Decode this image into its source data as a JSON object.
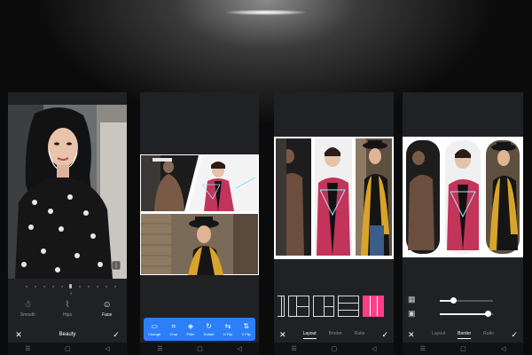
{
  "screens": {
    "beauty": {
      "slider_value": "0",
      "tools": [
        {
          "label": "Smooth",
          "icon": "smooth-icon"
        },
        {
          "label": "Hips",
          "icon": "hips-icon"
        },
        {
          "label": "Face",
          "icon": "face-icon",
          "active": true
        }
      ],
      "title": "Beauty"
    },
    "editor": {
      "tools": [
        {
          "label": "Change",
          "icon": "change-icon"
        },
        {
          "label": "Crop",
          "icon": "crop-icon"
        },
        {
          "label": "Filter",
          "icon": "filter-icon"
        },
        {
          "label": "Rotate",
          "icon": "rotate-icon"
        },
        {
          "label": "H Flip",
          "icon": "hflip-icon"
        },
        {
          "label": "V Flip",
          "icon": "vflip-icon"
        }
      ],
      "accent": "#2d7ff9"
    },
    "layout": {
      "tabs": [
        "Layout",
        "Border",
        "Ratio"
      ],
      "active_tab": "Layout",
      "accent": "#ff3e8a"
    },
    "border": {
      "tabs": [
        "Layout",
        "Border",
        "Ratio"
      ],
      "active_tab": "Border",
      "slider_1": 0.25,
      "slider_2": 0.9
    }
  }
}
